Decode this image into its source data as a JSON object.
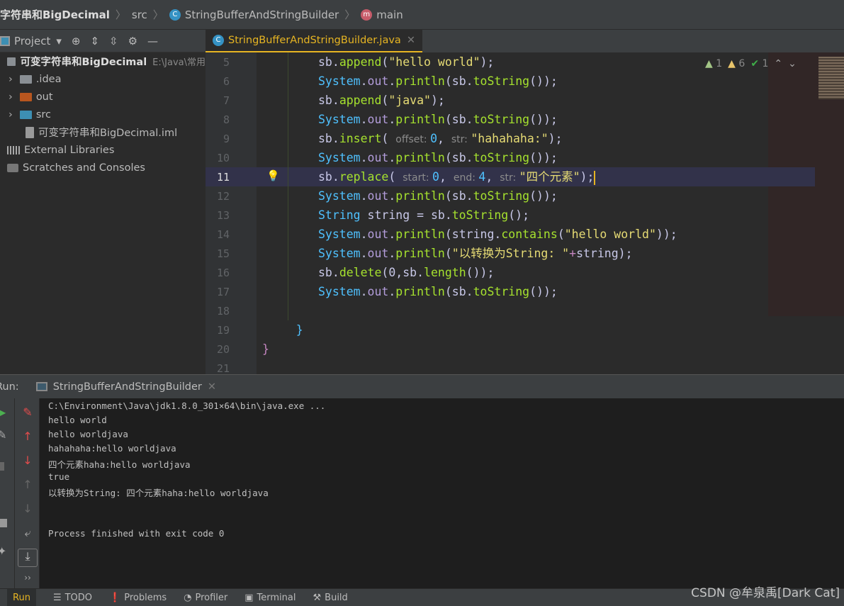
{
  "breadcrumb": {
    "project": "字符串和BigDecimal",
    "src": "src",
    "class": "StringBufferAndStringBuilder",
    "method": "main"
  },
  "project_bar": {
    "title": "Project"
  },
  "tree": [
    {
      "label": "可变字符串和BigDecimal",
      "extra": "E:\\Java\\常用",
      "type": "module",
      "bold": true
    },
    {
      "label": ".idea",
      "type": "folder",
      "color": "#8a8f94"
    },
    {
      "label": "out",
      "type": "folder",
      "color": "#b8561f"
    },
    {
      "label": "src",
      "type": "folder",
      "color": "#3d8fb3"
    },
    {
      "label": "可变字符串和BigDecimal.iml",
      "type": "file"
    },
    {
      "label": "External Libraries",
      "type": "libraries"
    },
    {
      "label": "Scratches and Consoles",
      "type": "scratches"
    }
  ],
  "editor": {
    "tab": "StringBufferAndStringBuilder.java",
    "current_line": 11,
    "inspections": {
      "errors": "1",
      "warnings": "6",
      "ok": "1"
    },
    "lines": [
      {
        "n": "5",
        "tokens": [
          [
            "id",
            "sb"
          ],
          [
            "p",
            "."
          ],
          [
            "m",
            "append"
          ],
          [
            "p",
            "("
          ],
          [
            "s",
            "\"hello world\""
          ],
          [
            "p",
            ");"
          ]
        ]
      },
      {
        "n": "6",
        "tokens": [
          [
            "sys",
            "System"
          ],
          [
            "p",
            "."
          ],
          [
            "fld",
            "out"
          ],
          [
            "p",
            "."
          ],
          [
            "m",
            "println"
          ],
          [
            "p",
            "(sb."
          ],
          [
            "m",
            "toString"
          ],
          [
            "p",
            "());"
          ]
        ]
      },
      {
        "n": "7",
        "tokens": [
          [
            "id",
            "sb"
          ],
          [
            "p",
            "."
          ],
          [
            "m",
            "append"
          ],
          [
            "p",
            "("
          ],
          [
            "s",
            "\"java\""
          ],
          [
            "p",
            ");"
          ]
        ]
      },
      {
        "n": "8",
        "tokens": [
          [
            "sys",
            "System"
          ],
          [
            "p",
            "."
          ],
          [
            "fld",
            "out"
          ],
          [
            "p",
            "."
          ],
          [
            "m",
            "println"
          ],
          [
            "p",
            "(sb."
          ],
          [
            "m",
            "toString"
          ],
          [
            "p",
            "());"
          ]
        ]
      },
      {
        "n": "9",
        "tokens": [
          [
            "id",
            "sb"
          ],
          [
            "p",
            "."
          ],
          [
            "m",
            "insert"
          ],
          [
            "p",
            "( "
          ],
          [
            "h",
            "offset: "
          ],
          [
            "n",
            "0"
          ],
          [
            "p",
            ", "
          ],
          [
            "h",
            "str: "
          ],
          [
            "s",
            "\"hahahaha:\""
          ],
          [
            "p",
            ");"
          ]
        ]
      },
      {
        "n": "10",
        "tokens": [
          [
            "sys",
            "System"
          ],
          [
            "p",
            "."
          ],
          [
            "fld",
            "out"
          ],
          [
            "p",
            "."
          ],
          [
            "m",
            "println"
          ],
          [
            "p",
            "(sb."
          ],
          [
            "m",
            "toString"
          ],
          [
            "p",
            "());"
          ]
        ]
      },
      {
        "n": "11",
        "tokens": [
          [
            "id",
            "sb"
          ],
          [
            "p",
            "."
          ],
          [
            "m",
            "replace"
          ],
          [
            "p",
            "( "
          ],
          [
            "h",
            "start: "
          ],
          [
            "n",
            "0"
          ],
          [
            "p",
            ", "
          ],
          [
            "h",
            "end: "
          ],
          [
            "n",
            "4"
          ],
          [
            "p",
            ", "
          ],
          [
            "h",
            "str: "
          ],
          [
            "s",
            "\"四个元素\""
          ],
          [
            "p",
            ");"
          ]
        ]
      },
      {
        "n": "12",
        "tokens": [
          [
            "sys",
            "System"
          ],
          [
            "p",
            "."
          ],
          [
            "fld",
            "out"
          ],
          [
            "p",
            "."
          ],
          [
            "m",
            "println"
          ],
          [
            "p",
            "(sb."
          ],
          [
            "m",
            "toString"
          ],
          [
            "p",
            "());"
          ]
        ]
      },
      {
        "n": "13",
        "tokens": [
          [
            "type",
            "String"
          ],
          [
            "p",
            " string = sb."
          ],
          [
            "m",
            "toString"
          ],
          [
            "p",
            "();"
          ]
        ]
      },
      {
        "n": "14",
        "tokens": [
          [
            "sys",
            "System"
          ],
          [
            "p",
            "."
          ],
          [
            "fld",
            "out"
          ],
          [
            "p",
            "."
          ],
          [
            "m",
            "println"
          ],
          [
            "p",
            "(string."
          ],
          [
            "m",
            "contains"
          ],
          [
            "p",
            "("
          ],
          [
            "s",
            "\"hello world\""
          ],
          [
            "p",
            "));"
          ]
        ]
      },
      {
        "n": "15",
        "tokens": [
          [
            "sys",
            "System"
          ],
          [
            "p",
            "."
          ],
          [
            "fld",
            "out"
          ],
          [
            "p",
            "."
          ],
          [
            "m",
            "println"
          ],
          [
            "p",
            "("
          ],
          [
            "s",
            "\"以转换为String: \""
          ],
          [
            "plus",
            "+"
          ],
          [
            "p",
            "string);"
          ]
        ]
      },
      {
        "n": "16",
        "tokens": [
          [
            "id",
            "sb"
          ],
          [
            "p",
            "."
          ],
          [
            "m",
            "delete"
          ],
          [
            "p",
            "(0,sb."
          ],
          [
            "m",
            "length"
          ],
          [
            "p",
            "());"
          ]
        ]
      },
      {
        "n": "17",
        "tokens": [
          [
            "sys",
            "System"
          ],
          [
            "p",
            "."
          ],
          [
            "fld",
            "out"
          ],
          [
            "p",
            "."
          ],
          [
            "m",
            "println"
          ],
          [
            "p",
            "(sb."
          ],
          [
            "m",
            "toString"
          ],
          [
            "p",
            "());"
          ]
        ]
      },
      {
        "n": "18",
        "tokens": []
      },
      {
        "n": "19",
        "tokens": [
          [
            "br",
            "    }"
          ]
        ],
        "indent": -1
      },
      {
        "n": "20",
        "tokens": [
          [
            "plus",
            "}"
          ]
        ],
        "indent": -2
      },
      {
        "n": "21",
        "tokens": []
      }
    ]
  },
  "run": {
    "label": "Run:",
    "tab": "StringBufferAndStringBuilder",
    "output": [
      "C:\\Environment\\Java\\jdk1.8.0_301×64\\bin\\java.exe ...",
      "hello world",
      "hello worldjava",
      "hahahaha:hello worldjava",
      "四个元素haha:hello worldjava",
      "true",
      "以转换为String: 四个元素haha:hello worldjava",
      "",
      "",
      "Process finished with exit code 0"
    ]
  },
  "statusbar": {
    "run": "Run",
    "todo": "TODO",
    "problems": "Problems",
    "profiler": "Profiler",
    "terminal": "Terminal",
    "build": "Build"
  },
  "watermark": "CSDN @牟泉禹[Dark Cat]",
  "colors": {
    "accent": "#e6b422",
    "string": "#e6db74",
    "method": "#a6e22e",
    "system": "#4fc1ff"
  }
}
